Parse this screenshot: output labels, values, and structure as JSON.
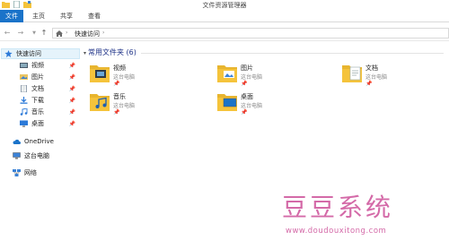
{
  "window": {
    "title": "文件资源管理器"
  },
  "ribbon": {
    "tabs": [
      "文件",
      "主页",
      "共享",
      "查看"
    ]
  },
  "address": {
    "path": [
      "快速访问"
    ]
  },
  "sidebar": {
    "quick_access": "快速访问",
    "items": [
      "视频",
      "图片",
      "文档",
      "下载",
      "音乐",
      "桌面"
    ],
    "onedrive": "OneDrive",
    "this_pc": "这台电脑",
    "network": "网络"
  },
  "main": {
    "group_title": "常用文件夹 (6)",
    "folders": [
      {
        "name": "视频",
        "location": "这台电脑",
        "icon": "video-folder-icon"
      },
      {
        "name": "图片",
        "location": "这台电脑",
        "icon": "pictures-folder-icon"
      },
      {
        "name": "文档",
        "location": "这台电脑",
        "icon": "documents-folder-icon"
      },
      {
        "name": "音乐",
        "location": "这台电脑",
        "icon": "music-folder-icon"
      },
      {
        "name": "桌面",
        "location": "这台电脑",
        "icon": "desktop-folder-icon"
      }
    ]
  },
  "watermark": {
    "text": "豆豆系统",
    "url": "www.doudouxitong.com"
  },
  "colors": {
    "accent": "#1a73c9",
    "folder": "#f5c33b",
    "watermark": "#d46aa8"
  }
}
